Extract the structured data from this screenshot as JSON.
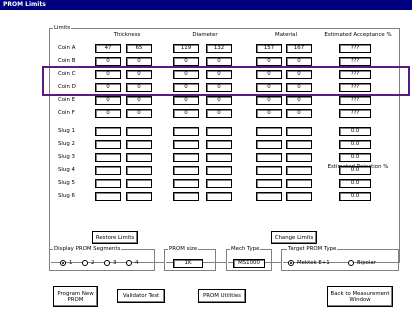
{
  "window": {
    "title": "PROM Limits"
  },
  "limits": {
    "legend": "Limits",
    "headers": {
      "thickness": "Thickness",
      "diameter": "Diameter",
      "material": "Material",
      "acceptance": "Estimated Acceptance %",
      "rejection": "Estimated Rejection %"
    },
    "coins": [
      {
        "label": "Coin A",
        "t1": "47",
        "t2": "65",
        "d1": "119",
        "d2": "132",
        "m1": "157",
        "m2": "167",
        "est": "???"
      },
      {
        "label": "Coin B",
        "t1": "0",
        "t2": "0",
        "d1": "0",
        "d2": "0",
        "m1": "0",
        "m2": "0",
        "est": "???"
      },
      {
        "label": "Coin C",
        "t1": "0",
        "t2": "0",
        "d1": "0",
        "d2": "0",
        "m1": "0",
        "m2": "0",
        "est": "???"
      },
      {
        "label": "Coin D",
        "t1": "0",
        "t2": "0",
        "d1": "0",
        "d2": "0",
        "m1": "0",
        "m2": "0",
        "est": "???"
      },
      {
        "label": "Coin E",
        "t1": "0",
        "t2": "0",
        "d1": "0",
        "d2": "0",
        "m1": "0",
        "m2": "0",
        "est": "???"
      },
      {
        "label": "Coin F",
        "t1": "0",
        "t2": "0",
        "d1": "0",
        "d2": "0",
        "m1": "0",
        "m2": "0",
        "est": "???"
      }
    ],
    "slugs": [
      {
        "label": "Slug 1",
        "est": "0.0"
      },
      {
        "label": "Slug 2",
        "est": "0.0"
      },
      {
        "label": "Slug 3",
        "est": "0.0"
      },
      {
        "label": "Slug 4",
        "est": "0.0"
      },
      {
        "label": "Slug 5",
        "est": "0.0"
      },
      {
        "label": "Slug 6",
        "est": "0.0"
      }
    ],
    "restore_button": "Restore Limits",
    "change_button": "Change Limits"
  },
  "segments": {
    "legend": "Display PROM Segments",
    "options": [
      "1",
      "2",
      "3",
      "4"
    ],
    "selected": "1"
  },
  "prom_size": {
    "legend": "PROM size",
    "value": "1K"
  },
  "mech_type": {
    "legend": "Mech Type",
    "value": "MS1000"
  },
  "target_type": {
    "legend": "Target PROM Type",
    "options": [
      "Mektek E+1",
      "Bipolar"
    ],
    "selected": "Mektek E+1"
  },
  "buttons": {
    "program": "Program New PROM",
    "validate": "Validator Test",
    "utilities": "PROM Utilities",
    "back": "Back to Measurement Window"
  },
  "colors": {
    "titlebar": "#000080",
    "highlight": "#5a1a82"
  }
}
